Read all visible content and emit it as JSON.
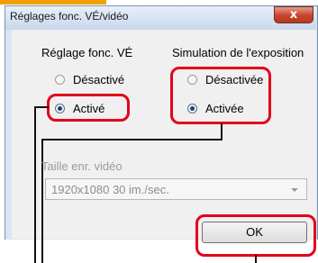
{
  "window": {
    "title": "Réglages fonc. VÉ/vidéo",
    "close_glyph": "x"
  },
  "live_view": {
    "heading": "Réglage fonc. VÉ",
    "options": [
      {
        "label": "Désactivé",
        "selected": false
      },
      {
        "label": "Activé",
        "selected": true
      }
    ]
  },
  "exposure_simulation": {
    "heading": "Simulation de l'exposition",
    "options": [
      {
        "label": "Désactivée",
        "selected": false
      },
      {
        "label": "Activée",
        "selected": true
      }
    ]
  },
  "movie_size": {
    "label": "Taille enr. vidéo",
    "value": "1920x1080  30 im./sec.",
    "enabled": false
  },
  "buttons": {
    "ok_label": "OK"
  },
  "colors": {
    "highlight": "#e3001b",
    "top_tab": "#f0a000"
  }
}
